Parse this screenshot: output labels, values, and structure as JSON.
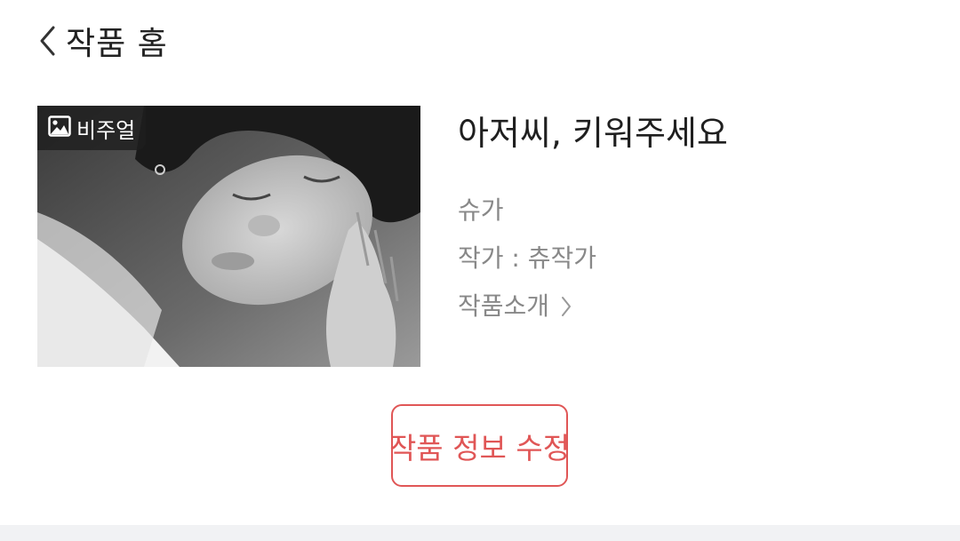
{
  "header": {
    "title": "작품 홈",
    "back_icon": "chevron-left-icon"
  },
  "work": {
    "thumbnail_badge": {
      "icon": "image-icon",
      "label": "비주얼"
    },
    "title": "아저씨, 키워주세요",
    "genre": "슈가",
    "author": "작가 : 츄작가",
    "intro_link": "작품소개",
    "intro_icon": "chevron-right-icon"
  },
  "actions": {
    "edit_label": "작품 정보 수정"
  },
  "colors": {
    "accent": "#e05656",
    "title_text": "#1f1f1f",
    "meta_text": "#888888",
    "divider": "#f1f2f4"
  }
}
